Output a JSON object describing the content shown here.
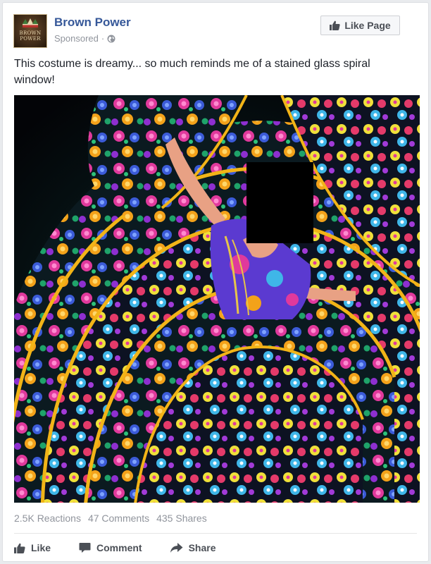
{
  "post": {
    "page_name": "Brown Power",
    "avatar_logo_line1": "BROWN",
    "avatar_logo_line2": "POWER",
    "sponsored_label": "Sponsored",
    "sponsored_separator": "·",
    "privacy_icon": "globe-icon",
    "like_page_label": "Like Page",
    "caption": "This costume is dreamy... so much reminds me of a stained glass spiral window!"
  },
  "stats": {
    "reactions": "2.5K Reactions",
    "comments": "47 Comments",
    "shares": "435 Shares"
  },
  "actions": {
    "like_label": "Like",
    "comment_label": "Comment",
    "share_label": "Share"
  },
  "colors": {
    "brand_link": "#365899",
    "meta_gray": "#90949c",
    "button_text": "#4b4f56"
  }
}
